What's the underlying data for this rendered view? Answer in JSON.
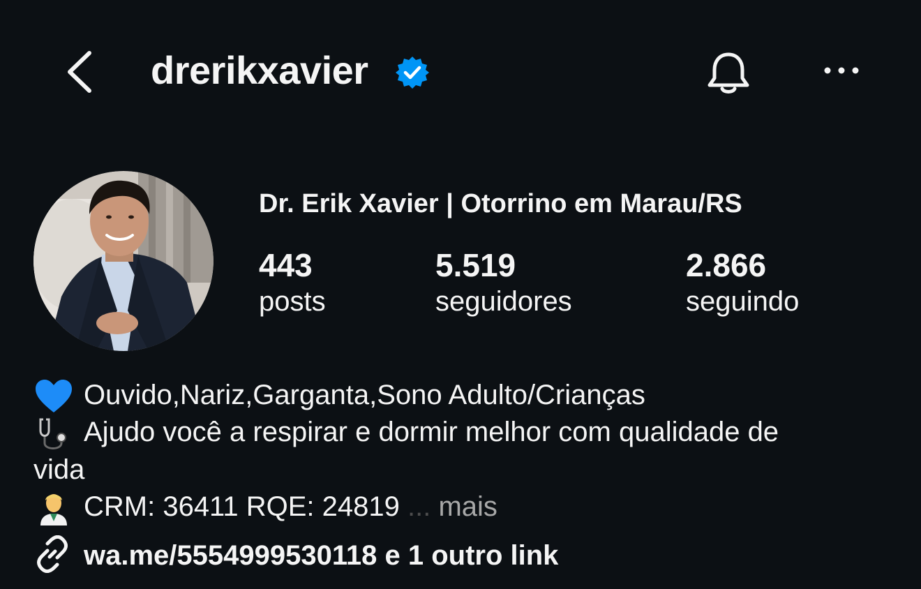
{
  "header": {
    "username": "drerikxavier",
    "verified": true
  },
  "profile": {
    "full_name": "Dr. Erik Xavier | Otorrino em Marau/RS",
    "stats": [
      {
        "value": "443",
        "label": "posts"
      },
      {
        "value": "5.519",
        "label": "seguidores"
      },
      {
        "value": "2.866",
        "label": "seguindo"
      }
    ]
  },
  "bio": {
    "line1": "Ouvido,Nariz,Garganta,Sono Adulto/Crianças",
    "line2a": "Ajudo você a respirar e dormir melhor com qualidade de",
    "line2b": "vida",
    "line3": "CRM: 36411 RQE: 24819",
    "ellipsis": "...",
    "more": "mais",
    "link": "wa.me/5554999530118 e 1 outro link",
    "icons": [
      "blue-heart-emoji",
      "stethoscope-emoji",
      "health-worker-emoji",
      "link-icon"
    ]
  },
  "colors": {
    "background": "#0c1014",
    "text": "#f5f5f5",
    "verified": "#0095f6",
    "muted": "#a8a8a8"
  }
}
